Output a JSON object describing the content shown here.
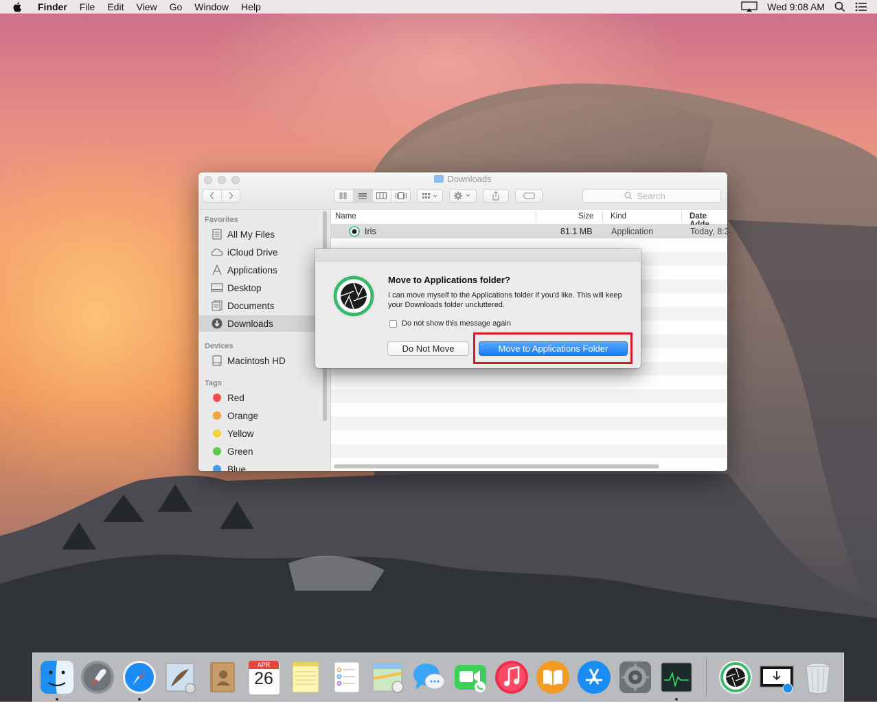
{
  "menubar": {
    "app_name": "Finder",
    "menus": [
      "File",
      "Edit",
      "View",
      "Go",
      "Window",
      "Help"
    ],
    "clock": "Wed 9:08 AM"
  },
  "finder": {
    "title": "Downloads",
    "search_placeholder": "Search",
    "sidebar": {
      "favorites_header": "Favorites",
      "favorites": [
        {
          "label": "All My Files",
          "icon": "all-files-icon"
        },
        {
          "label": "iCloud Drive",
          "icon": "cloud-icon"
        },
        {
          "label": "Applications",
          "icon": "applications-icon"
        },
        {
          "label": "Desktop",
          "icon": "desktop-icon"
        },
        {
          "label": "Documents",
          "icon": "documents-icon"
        },
        {
          "label": "Downloads",
          "icon": "downloads-icon",
          "selected": true
        }
      ],
      "devices_header": "Devices",
      "devices": [
        {
          "label": "Macintosh HD",
          "icon": "harddisk-icon"
        }
      ],
      "tags_header": "Tags",
      "tags": [
        {
          "label": "Red",
          "color": "#f04d4d"
        },
        {
          "label": "Orange",
          "color": "#f5a33a"
        },
        {
          "label": "Yellow",
          "color": "#f3d43c"
        },
        {
          "label": "Green",
          "color": "#5cc94c"
        },
        {
          "label": "Blue",
          "color": "#3f9ef0"
        }
      ]
    },
    "columns": {
      "name": "Name",
      "size": "Size",
      "kind": "Kind",
      "date": "Date Adde"
    },
    "files": [
      {
        "name": "Iris",
        "size": "81.1 MB",
        "kind": "Application",
        "date": "Today, 8:3"
      }
    ]
  },
  "dialog": {
    "title": "Move to Applications folder?",
    "message": "I can move myself to the Applications folder if you'd like. This will keep your Downloads folder uncluttered.",
    "checkbox_label": "Do not show this message again",
    "secondary_button": "Do Not Move",
    "primary_button": "Move to Applications Folder"
  },
  "dock": {
    "calendar_month": "APR",
    "calendar_day": "26"
  },
  "colors": {
    "accent": "#1a7cf5",
    "highlight_box": "#d3192a"
  }
}
